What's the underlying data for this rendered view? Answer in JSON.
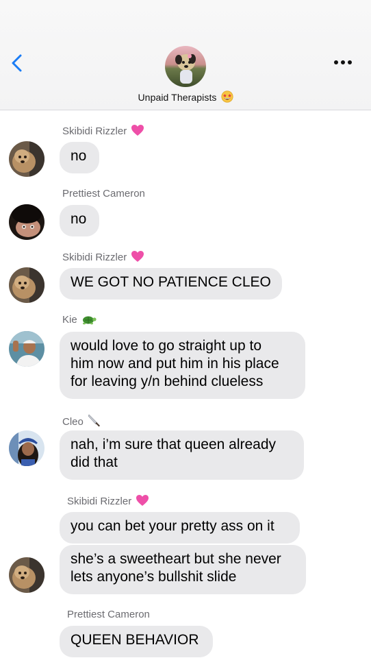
{
  "header": {
    "group_name": "Unpaid Therapists",
    "group_emoji_icon": "star-struck-face-icon"
  },
  "messages": [
    {
      "sender": "Skibidi Rizzler",
      "sender_emoji_icon": "pink-heart-icon",
      "lines": [
        "no"
      ],
      "avatar_icon": "dog-avatar-icon"
    },
    {
      "sender": "Prettiest Cameron",
      "lines": [
        "no"
      ],
      "avatar_icon": "person-avatar-icon"
    },
    {
      "sender": "Skibidi Rizzler",
      "sender_emoji_icon": "pink-heart-icon",
      "lines": [
        "WE GOT NO PATIENCE CLEO"
      ],
      "avatar_icon": "dog-avatar-icon"
    },
    {
      "sender": "Kie",
      "sender_emoji_icon": "turtle-icon",
      "lines": [
        "would love to go straight up to",
        "him now and put him in his place",
        "for leaving y/n behind clueless"
      ],
      "avatar_icon": "person-avatar-icon"
    },
    {
      "sender": "Cleo",
      "sender_emoji_icon": "knife-icon",
      "lines": [
        "nah, i’m sure that queen already",
        "did that"
      ],
      "avatar_icon": "person-avatar-icon"
    },
    {
      "sender": "Skibidi Rizzler",
      "sender_emoji_icon": "pink-heart-icon",
      "lines": [
        "you can bet your pretty ass on it"
      ]
    },
    {
      "lines": [
        "she’s a sweetheart but she never",
        "lets anyone’s bullshit slide"
      ],
      "avatar_icon": "dog-avatar-icon"
    },
    {
      "sender": "Prettiest Cameron",
      "lines": [
        "QUEEN BEHAVIOR"
      ]
    }
  ]
}
